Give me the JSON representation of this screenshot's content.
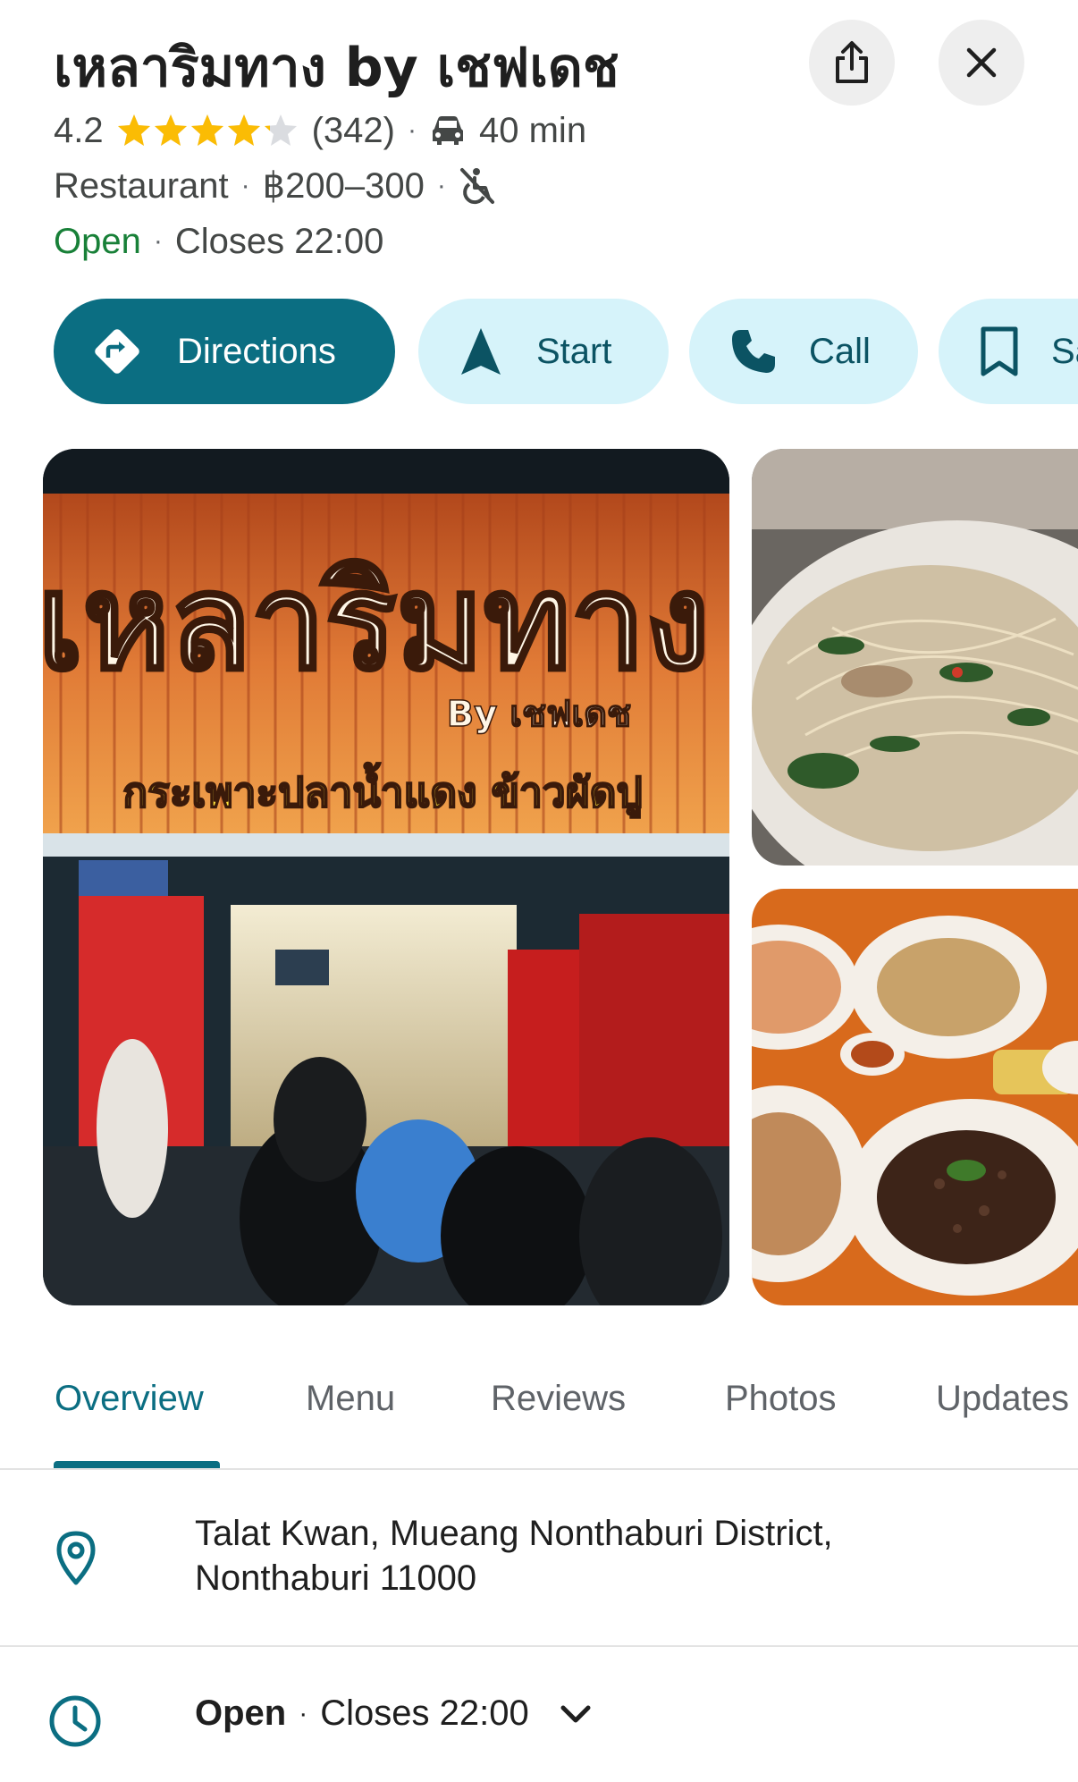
{
  "place": {
    "name": "เหลาริมทาง by เชฟเดช",
    "rating": "4.2",
    "star_fill": [
      1,
      1,
      1,
      1,
      0.2
    ],
    "review_count": "(342)",
    "travel_time": "40 min",
    "category": "Restaurant",
    "price_range": "฿200–300",
    "status": "Open",
    "closes": "Closes 22:00",
    "separator": "·"
  },
  "actions": [
    {
      "label": "Directions",
      "icon": "directions-icon"
    },
    {
      "label": "Start",
      "icon": "navigation-arrow-icon"
    },
    {
      "label": "Call",
      "icon": "phone-icon"
    },
    {
      "label": "Save",
      "icon": "bookmark-icon"
    }
  ],
  "photos": {
    "main_sign_text": "เหลาริมทาง",
    "main_sign_sub": "By เชฟเดช",
    "main_sign_tagline": "กระเพาะปลาน้ำแดง ข้าวผัดปู"
  },
  "tabs": [
    "Overview",
    "Menu",
    "Reviews",
    "Photos",
    "Updates"
  ],
  "active_tab": "Overview",
  "address": {
    "line1": "Talat Kwan, Mueang Nonthaburi District,",
    "line2": "Nonthaburi 11000"
  },
  "hours": {
    "status": "Open",
    "closes": "Closes 22:00"
  },
  "colors": {
    "accent": "#0b6e82",
    "secondary_bg": "#d6f3fa",
    "open_green": "#188038",
    "star": "#fbbc04"
  }
}
